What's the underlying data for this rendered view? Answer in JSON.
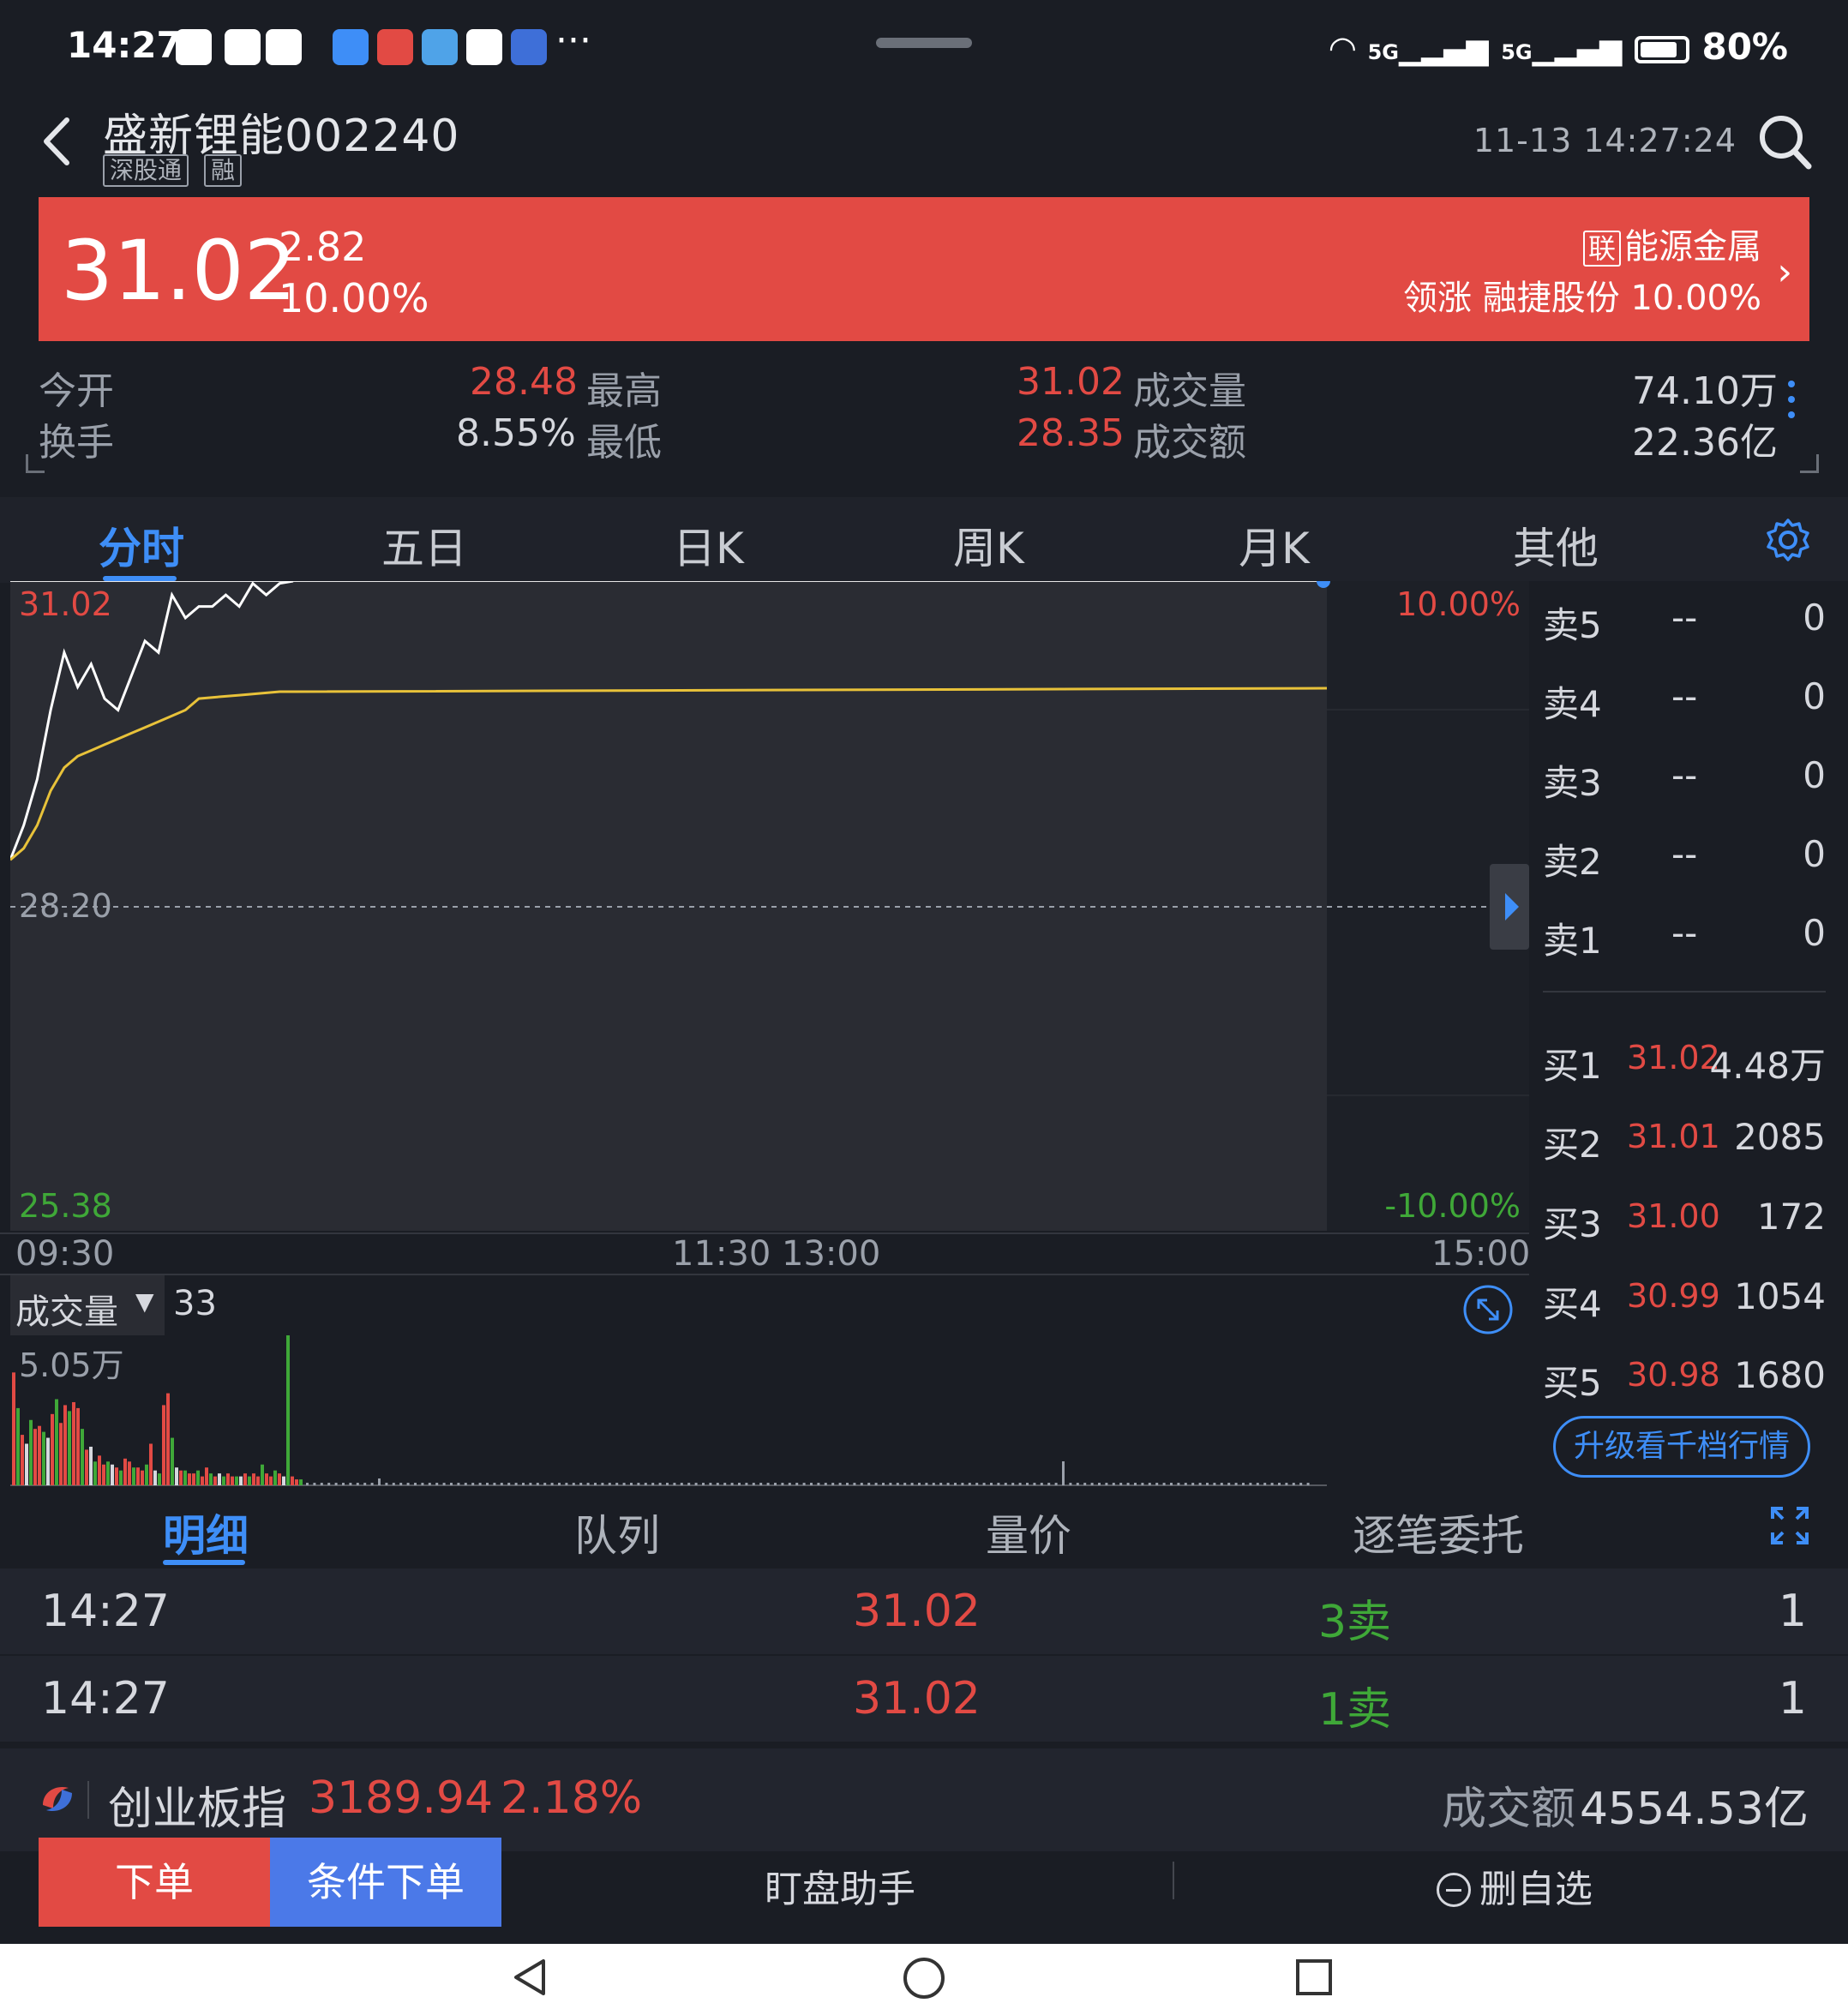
{
  "status_bar": {
    "time": "14:27",
    "more": "···",
    "network_1": "5G",
    "network_2": "5G",
    "battery": "80%"
  },
  "header": {
    "title": "盛新锂能002240",
    "tag_1": "深股通",
    "tag_2": "融",
    "datetime": "11-13 14:27:24"
  },
  "quote": {
    "price": "31.02",
    "change": "2.82",
    "change_pct": "10.00%",
    "sector_tag": "联",
    "sector_name": "能源金属",
    "sector_leader": "领涨 融捷股份 10.00%"
  },
  "stats": {
    "open_label": "今开",
    "open": "28.48",
    "high_label": "最高",
    "high": "31.02",
    "volume_label": "成交量",
    "volume": "74.10万",
    "turnover_label": "换手",
    "turnover": "8.55%",
    "low_label": "最低",
    "low": "28.35",
    "amount_label": "成交额",
    "amount": "22.36亿"
  },
  "tabs": [
    "分时",
    "五日",
    "日K",
    "周K",
    "月K",
    "其他"
  ],
  "chart": {
    "price_top": "31.02",
    "price_mid": "28.20",
    "price_bottom": "25.38",
    "pct_top": "10.00%",
    "pct_bottom": "-10.00%",
    "time_start": "09:30",
    "time_mid": "11:30 13:00",
    "time_end": "15:00"
  },
  "chart_data": {
    "type": "line",
    "title": "",
    "xlabel": "",
    "ylabel": "",
    "ylim": [
      25.38,
      31.02
    ],
    "x_ticks": [
      "09:30",
      "11:30 13:00",
      "15:00"
    ],
    "series": [
      {
        "values": [
          28.6,
          28.9,
          29.3,
          29.9,
          30.4,
          30.1,
          30.3,
          30.0,
          29.9,
          30.2,
          30.5,
          30.4,
          30.9,
          30.7,
          30.8,
          30.8,
          30.9,
          30.8,
          31.0,
          30.9,
          31.0,
          31.02
        ]
      },
      {
        "values": [
          28.6,
          28.7,
          28.9,
          29.2,
          29.4,
          29.5,
          29.55,
          29.6,
          29.65,
          29.7,
          29.75,
          29.8,
          29.85,
          29.9,
          30.0,
          30.01,
          30.02,
          30.03,
          30.04,
          30.05,
          30.06,
          30.06
        ]
      }
    ],
    "volume": {
      "label": "成交量",
      "value": "33",
      "max_label": "5.05万",
      "bars": [
        3.8,
        2.6,
        1.7,
        1.4,
        2.2,
        1.9,
        2.0,
        1.8,
        1.6,
        2.4,
        2.9,
        2.1,
        2.7,
        2.5,
        2.8,
        2.6,
        1.9,
        1.2,
        1.3,
        0.8,
        1.0,
        0.7,
        0.8,
        0.7,
        0.6,
        0.5,
        0.9,
        0.8,
        0.6,
        0.6,
        0.5,
        0.7,
        1.4,
        0.5,
        0.4,
        2.7,
        3.1,
        1.6,
        0.6,
        0.5,
        0.5,
        0.4,
        0.4,
        0.5,
        0.3,
        0.6,
        0.4,
        0.3,
        0.4,
        0.3,
        0.4,
        0.3,
        0.3,
        0.3,
        0.4,
        0.3,
        0.4,
        0.3,
        0.7,
        0.4,
        0.3,
        0.5,
        0.4,
        0.3,
        5.05,
        0.3,
        0.2,
        0.2
      ]
    }
  },
  "order_book": {
    "asks": [
      {
        "label": "卖5",
        "price": "--",
        "vol": "0"
      },
      {
        "label": "卖4",
        "price": "--",
        "vol": "0"
      },
      {
        "label": "卖3",
        "price": "--",
        "vol": "0"
      },
      {
        "label": "卖2",
        "price": "--",
        "vol": "0"
      },
      {
        "label": "卖1",
        "price": "--",
        "vol": "0"
      }
    ],
    "bids": [
      {
        "label": "买1",
        "price": "31.02",
        "vol": "4.48万"
      },
      {
        "label": "买2",
        "price": "31.01",
        "vol": "2085"
      },
      {
        "label": "买3",
        "price": "31.00",
        "vol": "172"
      },
      {
        "label": "买4",
        "price": "30.99",
        "vol": "1054"
      },
      {
        "label": "买5",
        "price": "30.98",
        "vol": "1680"
      }
    ],
    "upgrade_label": "升级看千档行情"
  },
  "detail_tabs": [
    "明细",
    "队列",
    "量价",
    "逐笔委托"
  ],
  "ticks": [
    {
      "time": "14:27",
      "price": "31.02",
      "side": "3卖",
      "qty": "1"
    },
    {
      "time": "14:27",
      "price": "31.02",
      "side": "1卖",
      "qty": "1"
    }
  ],
  "index_bar": {
    "name": "创业板指",
    "value": "3189.94",
    "pct": "2.18%",
    "amount_label": "成交额",
    "amount": "4554.53亿"
  },
  "actions": {
    "order": "下单",
    "conditional": "条件下单",
    "assistant": "盯盘助手",
    "remove_watch": "删自选"
  },
  "colors": {
    "up": "#e24a44",
    "down": "#3fa838",
    "accent": "#3e8ef7",
    "avg_line": "#e8c23a"
  }
}
